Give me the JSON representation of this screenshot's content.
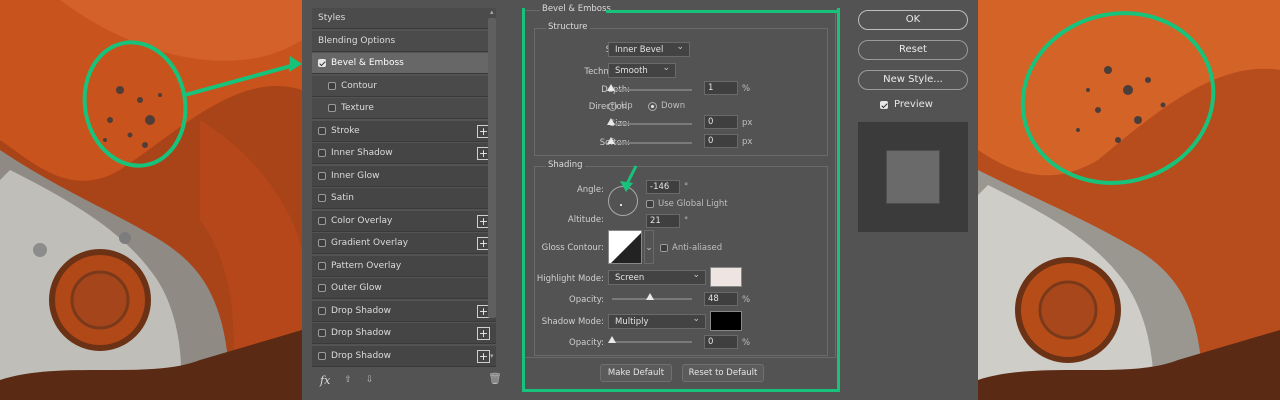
{
  "styles_list": {
    "items": [
      {
        "label": "Styles",
        "checkbox": false,
        "kind": "header"
      },
      {
        "label": "Blending Options",
        "checkbox": false,
        "kind": "header"
      },
      {
        "label": "Bevel & Emboss",
        "checkbox": true,
        "checked": true,
        "kind": "item",
        "selected": true
      },
      {
        "label": "Contour",
        "checkbox": true,
        "checked": false,
        "kind": "sub"
      },
      {
        "label": "Texture",
        "checkbox": true,
        "checked": false,
        "kind": "sub"
      },
      {
        "label": "Stroke",
        "checkbox": true,
        "checked": false,
        "plus": true
      },
      {
        "label": "Inner Shadow",
        "checkbox": true,
        "checked": false,
        "plus": true
      },
      {
        "label": "Inner Glow",
        "checkbox": true,
        "checked": false
      },
      {
        "label": "Satin",
        "checkbox": true,
        "checked": false
      },
      {
        "label": "Color Overlay",
        "checkbox": true,
        "checked": false,
        "plus": true
      },
      {
        "label": "Gradient Overlay",
        "checkbox": true,
        "checked": false,
        "plus": true
      },
      {
        "label": "Pattern Overlay",
        "checkbox": true,
        "checked": false
      },
      {
        "label": "Outer Glow",
        "checkbox": true,
        "checked": false
      },
      {
        "label": "Drop Shadow",
        "checkbox": true,
        "checked": false,
        "plus": true
      },
      {
        "label": "Drop Shadow",
        "checkbox": true,
        "checked": false,
        "plus": true
      },
      {
        "label": "Drop Shadow",
        "checkbox": true,
        "checked": false,
        "plus": true
      }
    ],
    "fx_label": "fx"
  },
  "panel": {
    "title": "Bevel & Emboss",
    "structure": {
      "title": "Structure",
      "style_label": "Style:",
      "style_value": "Inner Bevel",
      "technique_label": "Technique:",
      "technique_value": "Smooth",
      "depth_label": "Depth:",
      "depth_value": "1",
      "depth_unit": "%",
      "direction_label": "Direction:",
      "direction_up": "Up",
      "direction_down": "Down",
      "size_label": "Size:",
      "size_value": "0",
      "size_unit": "px",
      "soften_label": "Soften:",
      "soften_value": "0",
      "soften_unit": "px"
    },
    "shading": {
      "title": "Shading",
      "angle_label": "Angle:",
      "angle_value": "-146",
      "angle_unit": "°",
      "global_light_label": "Use Global Light",
      "altitude_label": "Altitude:",
      "altitude_value": "21",
      "altitude_unit": "°",
      "gloss_label": "Gloss Contour:",
      "anti_aliased_label": "Anti-aliased",
      "highlight_mode_label": "Highlight Mode:",
      "highlight_mode_value": "Screen",
      "highlight_color": "#eee4e1",
      "highlight_opacity_label": "Opacity:",
      "highlight_opacity_value": "48",
      "highlight_opacity_unit": "%",
      "highlight_opacity_fraction": 0.48,
      "shadow_mode_label": "Shadow Mode:",
      "shadow_mode_value": "Multiply",
      "shadow_color": "#000000",
      "shadow_opacity_label": "Opacity:",
      "shadow_opacity_value": "0",
      "shadow_opacity_unit": "%"
    },
    "make_default": "Make Default",
    "reset_default": "Reset to Default"
  },
  "right": {
    "ok": "OK",
    "reset": "Reset",
    "new_style": "New Style...",
    "preview_label": "Preview"
  },
  "colors": {
    "annotation_green": "#17c37b",
    "dialog_bg": "#535353"
  }
}
